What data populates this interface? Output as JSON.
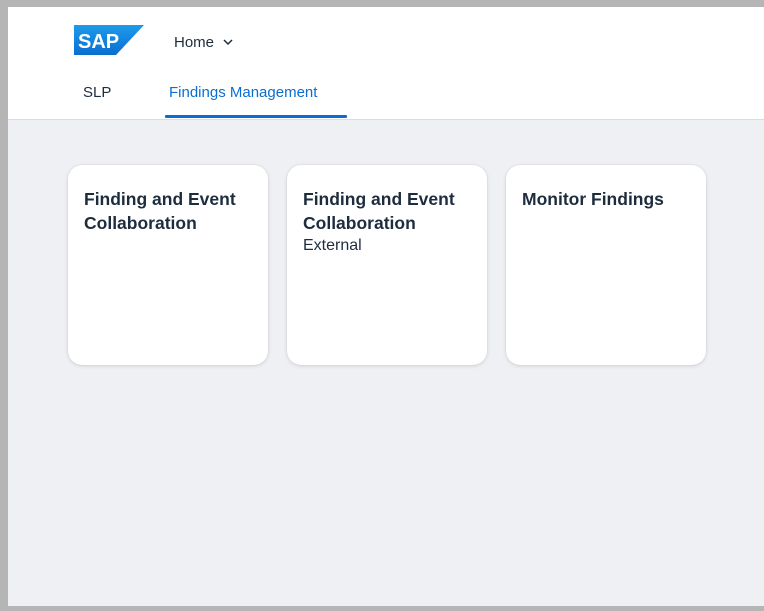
{
  "brand": {
    "logo_text": "SAP",
    "logo_color": "#0a6ed1"
  },
  "header": {
    "home_label": "Home",
    "home_icon": "chevron-down-icon"
  },
  "tabs": [
    {
      "label": "SLP",
      "selected": false
    },
    {
      "label": "Findings Management",
      "selected": true
    }
  ],
  "tiles": [
    {
      "title_line1": "Finding and Event",
      "title_line2": "Collaboration",
      "subtitle": ""
    },
    {
      "title_line1": "Finding and Event",
      "title_line2": "Collaboration",
      "subtitle": "External"
    },
    {
      "title_line1": "Monitor Findings",
      "title_line2": "",
      "subtitle": ""
    }
  ],
  "colors": {
    "accent": "#0a6ed1",
    "text": "#1d2d3e",
    "background": "#eef0f3"
  }
}
